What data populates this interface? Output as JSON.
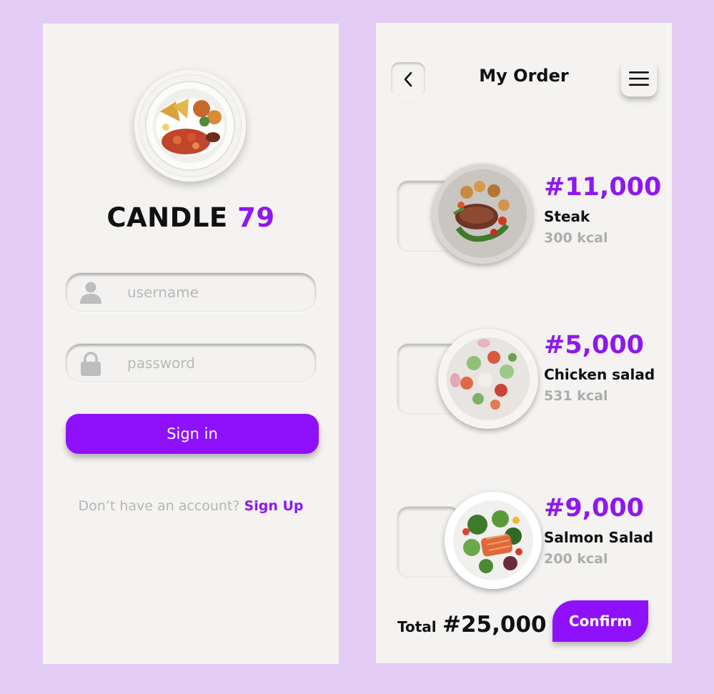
{
  "login": {
    "brand_name": "CANDLE",
    "brand_number": "79",
    "username_placeholder": "username",
    "password_placeholder": "password",
    "signin_label": "Sign in",
    "signup_prompt": "Don’t have an account?",
    "signup_link": "Sign Up",
    "icons": {
      "logo": "food-plate-logo",
      "username": "user-icon",
      "password": "lock-icon"
    }
  },
  "order": {
    "title": "My Order",
    "back_icon": "chevron-left-icon",
    "menu_icon": "hamburger-menu-icon",
    "items": [
      {
        "price": "#11,000",
        "name": "Steak",
        "kcal": "300 kcal"
      },
      {
        "price": "#5,000",
        "name": "Chicken salad",
        "kcal": "531 kcal"
      },
      {
        "price": "#9,000",
        "name": "Salmon Salad",
        "kcal": "200 kcal"
      }
    ],
    "total_label": "Total",
    "total_value": "#25,000",
    "confirm_label": "Confirm"
  },
  "colors": {
    "background": "#e3ccf4",
    "screen": "#f4f3f1",
    "accent": "#8f11fb",
    "muted_text": "#b5b5b5"
  }
}
